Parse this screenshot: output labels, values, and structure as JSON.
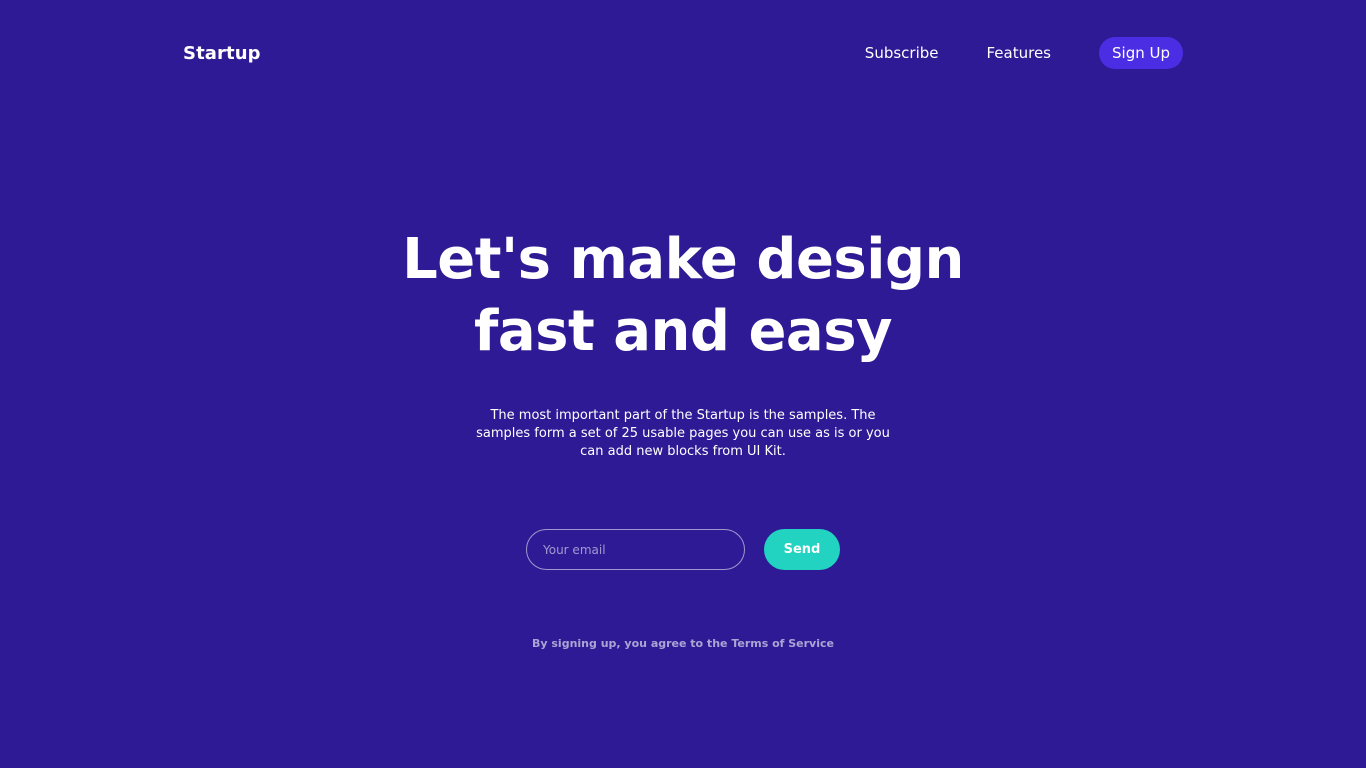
{
  "colors": {
    "background": "#2d1a94",
    "signup_button": "#4b2de3",
    "send_button": "#21d3c0",
    "text": "#ffffff"
  },
  "navbar": {
    "brand": "Startup",
    "links": [
      {
        "label": "Subscribe"
      },
      {
        "label": "Features"
      }
    ],
    "signup_label": "Sign Up"
  },
  "hero": {
    "title_line1": "Let's make design",
    "title_line2": "fast and easy",
    "description": "The most important part of the Startup is the samples. The samples form a set of 25 usable pages you can use as is or you can add new blocks from UI Kit."
  },
  "form": {
    "email_placeholder": "Your email",
    "email_value": "",
    "send_label": "Send"
  },
  "legal": {
    "prefix": "By signing up, you agree to the ",
    "terms_link": "Terms of Service"
  }
}
